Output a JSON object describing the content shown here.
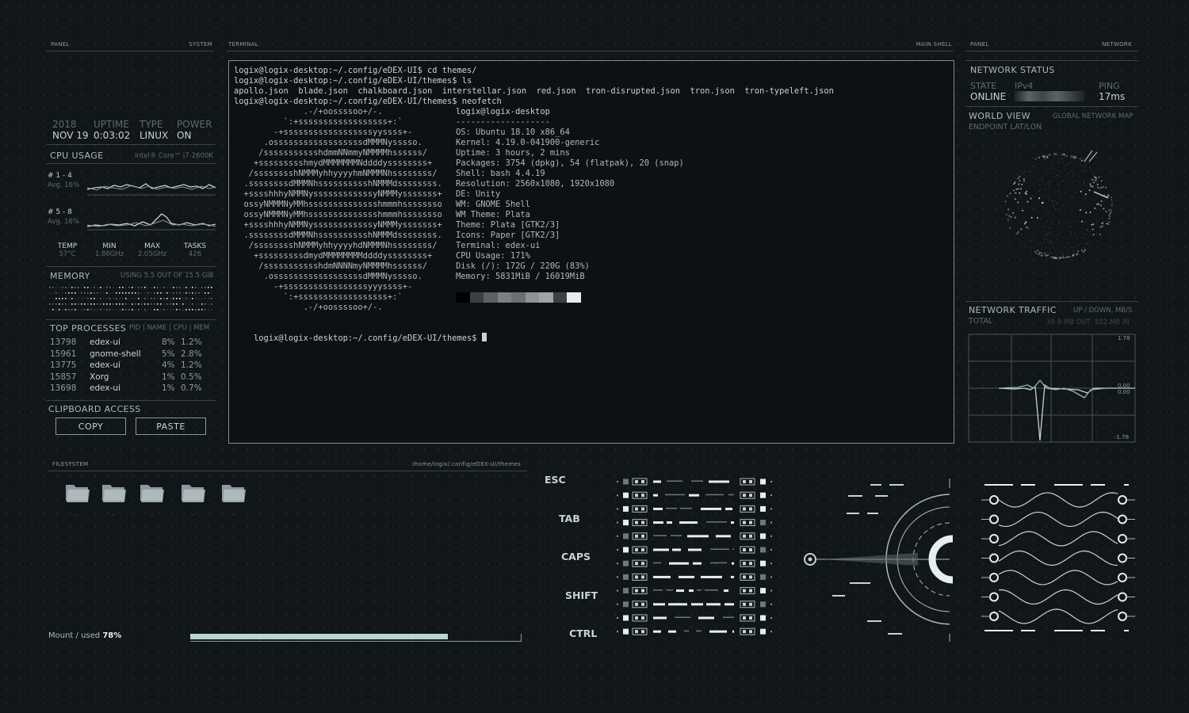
{
  "panels": {
    "left": {
      "title": "PANEL",
      "sub": "SYSTEM"
    },
    "terminal": {
      "title": "TERMINAL",
      "sub": "MAIN SHELL"
    },
    "right": {
      "title": "PANEL",
      "sub": "NETWORK"
    },
    "filesystem": {
      "title": "FILESYSTEM",
      "path": "/home/logix/.config/eDEX-UI/themes"
    }
  },
  "clock": {
    "year": "2018",
    "date": "NOV 19",
    "uptime_label": "UPTIME",
    "uptime": "0:03:02",
    "type_label": "TYPE",
    "type": "LINUX",
    "power_label": "POWER",
    "power": "ON"
  },
  "cpu": {
    "title": "CPU USAGE",
    "model": "Intel® Core™ i7-2600K",
    "group1": {
      "label": "# 1 - 4",
      "avg": "Avg. 16%"
    },
    "group2": {
      "label": "# 5 - 8",
      "avg": "Avg. 16%"
    },
    "stats": [
      {
        "label": "TEMP",
        "value": "57°C"
      },
      {
        "label": "MIN",
        "value": "1.86GHz"
      },
      {
        "label": "MAX",
        "value": "2.05GHz"
      },
      {
        "label": "TASKS",
        "value": "426"
      }
    ]
  },
  "memory": {
    "title": "MEMORY",
    "usage": "USING 5.5 OUT OF 15.5 GiB"
  },
  "processes": {
    "title": "TOP PROCESSES",
    "columns": "PID | NAME | CPU | MEM",
    "rows": [
      {
        "pid": "13798",
        "name": "edex-ui",
        "cpu": "8%",
        "mem": "1.2%"
      },
      {
        "pid": "15961",
        "name": "gnome-shell",
        "cpu": "5%",
        "mem": "2.8%"
      },
      {
        "pid": "13775",
        "name": "edex-ui",
        "cpu": "4%",
        "mem": "1.2%"
      },
      {
        "pid": "15857",
        "name": "Xorg",
        "cpu": "1%",
        "mem": "0.5%"
      },
      {
        "pid": "13698",
        "name": "edex-ui",
        "cpu": "1%",
        "mem": "0.7%"
      }
    ]
  },
  "clipboard": {
    "title": "CLIPBOARD ACCESS",
    "copy": "COPY",
    "paste": "PASTE"
  },
  "terminal": {
    "lines": [
      "logix@logix-desktop:~/.config/eDEX-UI$ cd themes/",
      "logix@logix-desktop:~/.config/eDEX-UI/themes$ ls",
      "apollo.json  blade.json  chalkboard.json  interstellar.json  red.json  tron-disrupted.json  tron.json  tron-typeleft.json",
      "logix@logix-desktop:~/.config/eDEX-UI/themes$ neofetch"
    ],
    "ascii": "              .-/+oossssoo+/-.\n          `:+ssssssssssssssssss+:`\n        -+ssssssssssssssssssyyssss+-\n      .ossssssssssssssssssdMMMNysssso.\n     /ssssssssssshdmmNNmmyNMMMMhssssss/\n    +ssssssssshmydMMMMMMMNddddyssssssss+\n   /sssssssshNMMMyhhyyyyhmNMMMNhssssssss/\n  .ssssssssdMMMNhsssssssssshNMMMdssssssss.\n  +sssshhhyNMMNyssssssssssssyNMMMysssssss+\n  ossyNMMMNyMMhsssssssssssssshmmmhssssssso\n  ossyNMMMNyMMhsssssssssssssshmmmhssssssso\n  +sssshhhyNMMNyssssssssssssyNMMMysssssss+\n  .ssssssssdMMMNhsssssssssshNMMMdssssssss.\n   /sssssssshNMMMyhhyyyyhdNMMMNhssssssss/\n    +sssssssssdmydMMMMMMMMddddyssssssss+\n     /ssssssssssshdmNNNNmyNMMMMhssssss/\n      .ossssssssssssssssssdMMMNysssso.\n        -+sssssssssssssssssyyyssss+-\n          `:+ssssssssssssssssss+:`\n              .-/+oossssoo+/-.",
    "info": [
      "logix@logix-desktop",
      "-------------------",
      "OS: Ubuntu 18.10 x86_64",
      "Kernel: 4.19.0-041900-generic",
      "Uptime: 3 hours, 2 mins",
      "Packages: 3754 (dpkg), 54 (flatpak), 20 (snap)",
      "Shell: bash 4.4.19",
      "Resolution: 2560x1080, 1920x1080",
      "DE: Unity",
      "WM: GNOME Shell",
      "WM Theme: Plata",
      "Theme: Plata [GTK2/3]",
      "Icons: Paper [GTK2/3]",
      "Terminal: edex-ui",
      "CPU Usage: 171%",
      "Disk (/): 172G / 220G (83%)",
      "Memory: 5831MiB / 16019MiB"
    ],
    "palette": [
      "#000000",
      "#3b3f42",
      "#5b6064",
      "#7a7f82",
      "#6b7073",
      "#8d9296",
      "#9ea3a6",
      "#3c4043",
      "#e8ecee"
    ],
    "prompt": "logix@logix-desktop:~/.config/eDEX-UI/themes$ "
  },
  "network": {
    "status_title": "NETWORK STATUS",
    "state_label": "STATE",
    "state": "ONLINE",
    "ipv4_label": "IPv4",
    "ping_label": "PING",
    "ping": "17ms",
    "world_title": "WORLD VIEW",
    "world_sub": "GLOBAL NETWORK MAP",
    "endpoint": "ENDPOINT LAT/LON",
    "traffic_title": "NETWORK TRAFFIC",
    "traffic_sub": "UP / DOWN, MB/S",
    "total_label": "TOTAL",
    "total": "39.9 MB OUT, 552 MB IN",
    "axis": {
      "top": "1.78",
      "mid1": "0.00",
      "mid2": "0.00",
      "bottom": "-1.78"
    }
  },
  "filesystem": {
    "folders": [
      "..",
      "..",
      "..",
      "..",
      ".."
    ],
    "mount_label": "Mount / used",
    "used": "78%",
    "used_fraction": 0.78
  },
  "keyboard": {
    "keys": [
      "ESC",
      "TAB",
      "CAPS",
      "SHIFT",
      "CTRL"
    ]
  }
}
